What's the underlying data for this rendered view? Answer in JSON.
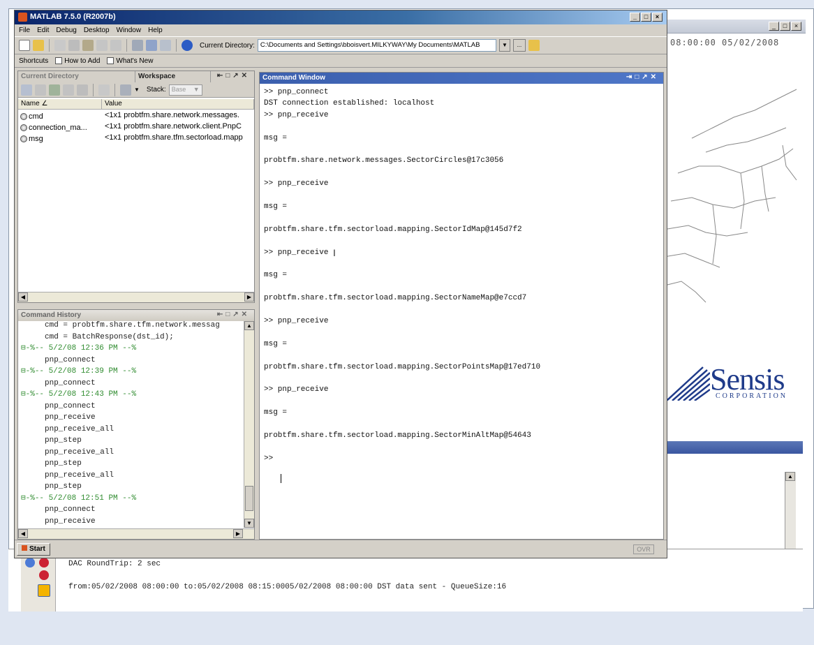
{
  "matlab": {
    "title": "MATLAB 7.5.0 (R2007b)",
    "menu": [
      "File",
      "Edit",
      "Debug",
      "Desktop",
      "Window",
      "Help"
    ],
    "toolbar": {
      "curdir_label": "Current Directory:",
      "curdir_value": "C:\\Documents and Settings\\bboisvert.MILKYWAY\\My Documents\\MATLAB",
      "browse_label": "..."
    },
    "shortcuts": {
      "label": "Shortcuts",
      "items": [
        "How to Add",
        "What's New"
      ]
    },
    "current_directory_tab": "Current Directory",
    "workspace": {
      "tab": "Workspace",
      "stack_label": "Stack:",
      "stack_value": "Base",
      "columns": [
        "Name ∠",
        "Value"
      ],
      "rows": [
        {
          "name": "cmd",
          "value": "<1x1 probtfm.share.network.messages."
        },
        {
          "name": "connection_ma...",
          "value": "<1x1 probtfm.share.network.client.PnpC"
        },
        {
          "name": "msg",
          "value": "<1x1 probtfm.share.tfm.sectorload.mapp"
        }
      ]
    },
    "command_history": {
      "title": "Command History",
      "lines": [
        {
          "type": "cmd",
          "indent": 2,
          "text": "cmd = probtfm.share.tfm.network.messag"
        },
        {
          "type": "cmd",
          "indent": 2,
          "text": "cmd = BatchResponse(dst_id);"
        },
        {
          "type": "ts",
          "indent": 0,
          "text": "⊟-%-- 5/2/08 12:36 PM --%"
        },
        {
          "type": "cmd",
          "indent": 2,
          "text": "pnp_connect"
        },
        {
          "type": "ts",
          "indent": 0,
          "text": "⊟-%-- 5/2/08 12:39 PM --%"
        },
        {
          "type": "cmd",
          "indent": 2,
          "text": "pnp_connect"
        },
        {
          "type": "ts",
          "indent": 0,
          "text": "⊟-%-- 5/2/08 12:43 PM --%"
        },
        {
          "type": "cmd",
          "indent": 2,
          "text": "pnp_connect"
        },
        {
          "type": "cmd",
          "indent": 2,
          "text": "pnp_receive"
        },
        {
          "type": "cmd",
          "indent": 2,
          "text": "pnp_receive_all"
        },
        {
          "type": "cmd",
          "indent": 2,
          "text": "pnp_step"
        },
        {
          "type": "cmd",
          "indent": 2,
          "text": "pnp_receive_all"
        },
        {
          "type": "cmd",
          "indent": 2,
          "text": "pnp_step"
        },
        {
          "type": "cmd",
          "indent": 2,
          "text": "pnp_receive_all"
        },
        {
          "type": "cmd",
          "indent": 2,
          "text": "pnp_step"
        },
        {
          "type": "ts",
          "indent": 0,
          "text": "⊟-%-- 5/2/08 12:51 PM --%"
        },
        {
          "type": "cmd",
          "indent": 2,
          "text": "pnp_connect"
        },
        {
          "type": "cmd",
          "indent": 2,
          "text": "pnp_receive"
        }
      ]
    },
    "command_window": {
      "title": "Command Window",
      "lines": [
        ">> pnp_connect",
        "DST connection established: localhost",
        ">> pnp_receive",
        "",
        "msg =",
        "",
        "probtfm.share.network.messages.SectorCircles@17c3056",
        "",
        ">> pnp_receive",
        "",
        "msg =",
        "",
        "probtfm.share.tfm.sectorload.mapping.SectorIdMap@145d7f2",
        "",
        ">> pnp_receive",
        "",
        "msg =",
        "",
        "probtfm.share.tfm.sectorload.mapping.SectorNameMap@e7ccd7",
        "",
        ">> pnp_receive",
        "",
        "msg =",
        "",
        "probtfm.share.tfm.sectorload.mapping.SectorPointsMap@17ed710",
        "",
        ">> pnp_receive",
        "",
        "msg =",
        "",
        "probtfm.share.tfm.sectorload.mapping.SectorMinAltMap@54643",
        "",
        ">> "
      ]
    },
    "statusbar": {
      "start_label": "Start",
      "ovr_label": "OVR"
    }
  },
  "background_app": {
    "map_timestamp": "08:00:00 05/02/2008",
    "logo_word": "Sensis",
    "logo_sub": "CORPORATION",
    "status_lines": [
      "DAC RoundTrip: 2 sec",
      "from:05/02/2008 08:00:00 to:05/02/2008 08:15:0005/02/2008 08:00:00 DST data sent - QueueSize:16"
    ]
  },
  "colors": {
    "matlab_title": "#0a246a",
    "active_panel": "#3b5fae",
    "history_timestamp": "#2e8b2e",
    "sensis_blue": "#1f3b8a"
  }
}
